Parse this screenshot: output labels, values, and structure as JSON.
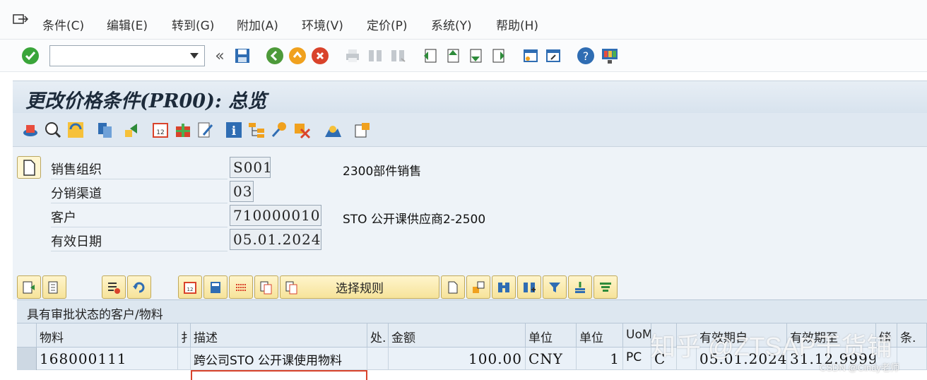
{
  "menu": {
    "items": [
      "条件(C)",
      "编辑(E)",
      "转到(G)",
      "附加(A)",
      "环境(V)",
      "定价(P)",
      "系统(Y)",
      "帮助(H)"
    ]
  },
  "toolbar": {
    "command_value": "",
    "back_symbol": "«"
  },
  "screen": {
    "title": "更改价格条件(PR00): 总览"
  },
  "header": {
    "fields": [
      {
        "label": "销售组织",
        "value": "S001",
        "desc": "2300部件销售"
      },
      {
        "label": "分销渠道",
        "value": "03",
        "desc": ""
      },
      {
        "label": "客户",
        "value": "710000010",
        "desc": "STO 公开课供应商2-2500"
      },
      {
        "label": "有效日期",
        "value": "05.01.2024",
        "desc": ""
      }
    ]
  },
  "table_toolbar": {
    "rule_button": "选择规则"
  },
  "table": {
    "title": "具有审批状态的客户/物料",
    "columns": [
      "物料",
      "扌",
      "描述",
      "处.",
      "金额",
      "单位",
      "单位",
      "UoM",
      "",
      "有效期自",
      "有效期至",
      "储",
      "条."
    ],
    "rows": [
      {
        "material": "168000111",
        "description": "跨公司STO 公开课使用物料",
        "amount": "100.00",
        "currency": "CNY",
        "per": "1",
        "uom": "PC",
        "calc": "C",
        "valid_from": "05.01.2024",
        "valid_to": "31.12.9999"
      }
    ]
  },
  "watermark": {
    "text": "知乎 @ZTSAP干货铺",
    "credit": "CSDN @Cindy老师"
  },
  "colors": {
    "title_bg": "#d8e3ee",
    "button_bg": "#f6e39a",
    "ok_green": "#3aa53a"
  }
}
